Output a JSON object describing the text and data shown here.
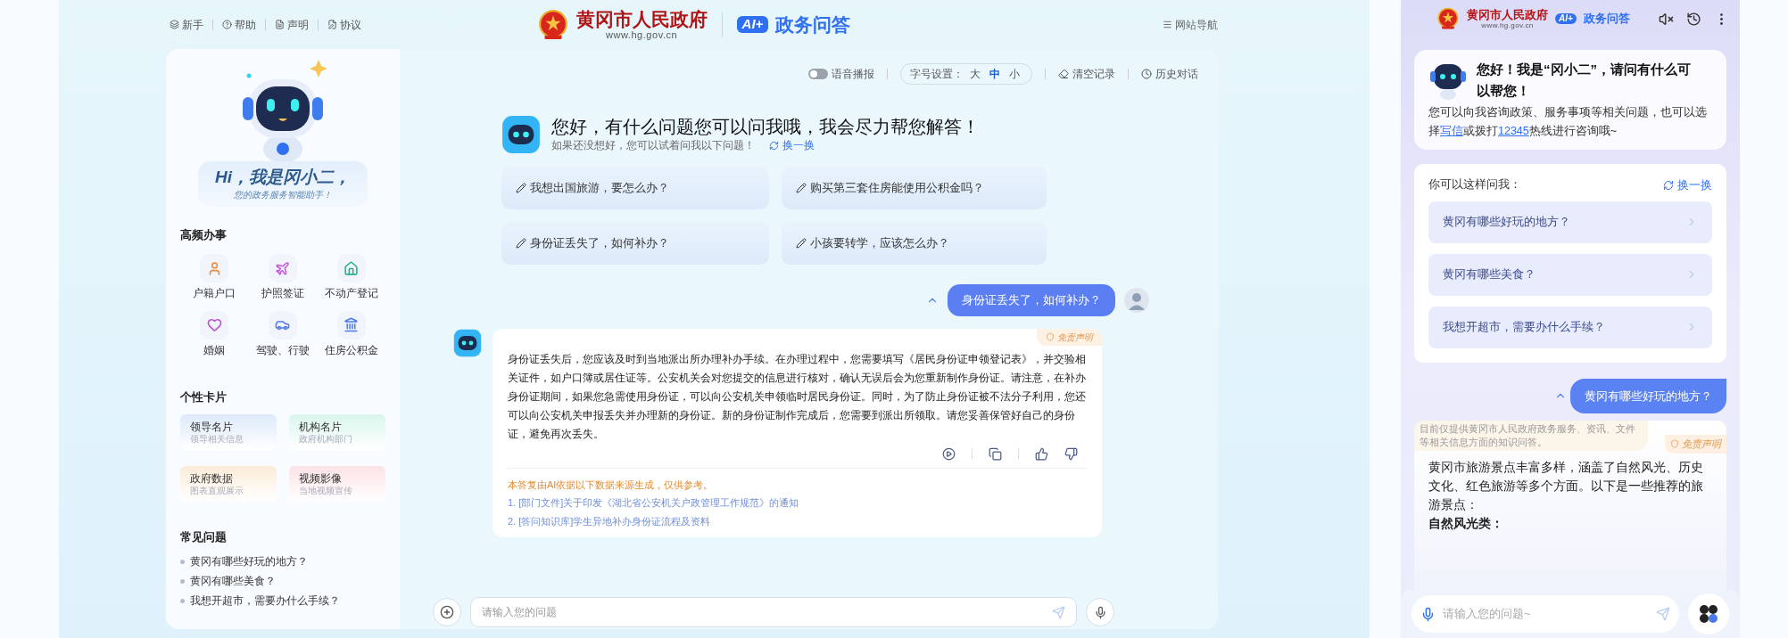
{
  "header": {
    "links": [
      {
        "label": "新手"
      },
      {
        "label": "帮助"
      },
      {
        "label": "声明"
      },
      {
        "label": "协议"
      }
    ],
    "site_name": "黄冈市人民政府",
    "site_url": "www.hg.gov.cn",
    "ai_badge": "AI+",
    "product": "政务问答",
    "nav": "网站导航"
  },
  "sidebar": {
    "hi_title": "Hi，我是冈小二，",
    "hi_subtitle": "您的政务服务智能助手！",
    "services_title": "高频办事",
    "services": [
      {
        "label": "户籍户口",
        "color": "#f08a3c"
      },
      {
        "label": "护照签证",
        "color": "#c45ad8"
      },
      {
        "label": "不动产登记",
        "color": "#22b08a"
      },
      {
        "label": "婚姻",
        "color": "#c04fd6"
      },
      {
        "label": "驾驶、行驶",
        "color": "#4f79e8"
      },
      {
        "label": "住房公积金",
        "color": "#4a7be6"
      }
    ],
    "cards_title": "个性卡片",
    "cards": [
      {
        "title": "领导名片",
        "subtitle": "领导相关信息"
      },
      {
        "title": "机构名片",
        "subtitle": "政府机构部门"
      },
      {
        "title": "政府数据",
        "subtitle": "图表直观展示"
      },
      {
        "title": "视频影像",
        "subtitle": "当地视频宣传"
      }
    ],
    "faq_title": "常见问题",
    "faq": [
      "黄冈有哪些好玩的地方？",
      "黄冈有哪些美食？",
      "我想开超市，需要办什么手续？"
    ]
  },
  "chat": {
    "toolbar": {
      "voice_label": "语音播报",
      "voice_on": false,
      "font_label": "字号设置：",
      "font_sizes": [
        {
          "label": "大",
          "selected": false
        },
        {
          "label": "中",
          "selected": true
        },
        {
          "label": "小",
          "selected": false
        }
      ],
      "clear": "清空记录",
      "history": "历史对话"
    },
    "greeting": {
      "title": "您好，有什么问题您可以问我哦，我会尽力帮您解答！",
      "hint": "如果还没想好，您可以试着问我以下问题！",
      "refresh": "换一换"
    },
    "suggestions": [
      "我想出国旅游，要怎么办？",
      "购买第三套住房能使用公积金吗？",
      "身份证丢失了，如何补办？",
      "小孩要转学，应该怎么办？"
    ],
    "user_message": "身份证丢失了，如何补办？",
    "answer": {
      "disclaimer": "免责声明",
      "text": "身份证丢失后，您应该及时到当地派出所办理补办手续。在办理过程中，您需要填写《居民身份证申领登记表》，并交验相关证件，如户口簿或居住证等。公安机关会对您提交的信息进行核对，确认无误后会为您重新制作身份证。请注意，在补办身份证期间，如果您急需使用身份证，可以向公安机关申领临时居民身份证。同时，为了防止身份证被不法分子利用，您还可以向公安机关申报丢失并办理新的身份证。新的身份证制作完成后，您需要到派出所领取。请您妥善保管好自己的身份证，避免再次丢失。",
      "sources_note": "本答复由AI依据以下数据来源生成，仅供参考。",
      "sources": [
        "1. [部门文件]关于印发《湖北省公安机关户政管理工作规范》的通知",
        "2. [答问知识库]学生异地补办身份证流程及资料"
      ]
    },
    "input": {
      "placeholder": "请输入您的问题"
    }
  },
  "mobile": {
    "header": {
      "site_name": "黄冈市人民政府",
      "site_url": "www.hg.gov.cn",
      "ai_badge": "AI+",
      "product": "政务问答"
    },
    "greeting": {
      "title": "您好！我是“冈小二”，请问有什么可以帮您！",
      "body_start": "您可以向我咨询政策、服务事项等相关问题，也可以选择",
      "link_letter": "写信",
      "body_middle": "或拨打",
      "link_phone": "12345",
      "body_end": "热线进行咨询哦~"
    },
    "suggest_title": "你可以这样问我：",
    "refresh": "换一换",
    "suggestions": [
      "黄冈有哪些好玩的地方？",
      "黄冈有哪些美食？",
      "我想开超市，需要办什么手续？"
    ],
    "user_message": "黄冈有哪些好玩的地方？",
    "notice": "目前仅提供黄冈市人民政府政务服务、资讯、文件等相关信息方面的知识问答。",
    "disclaimer": "免责声明",
    "answer": "黄冈市旅游景点丰富多样，涵盖了自然风光、历史文化、红色旅游等多个方面。以下是一些推荐的旅游景点：",
    "answer_heading": "自然风光类：",
    "input": {
      "placeholder": "请输入您的问题~"
    }
  }
}
